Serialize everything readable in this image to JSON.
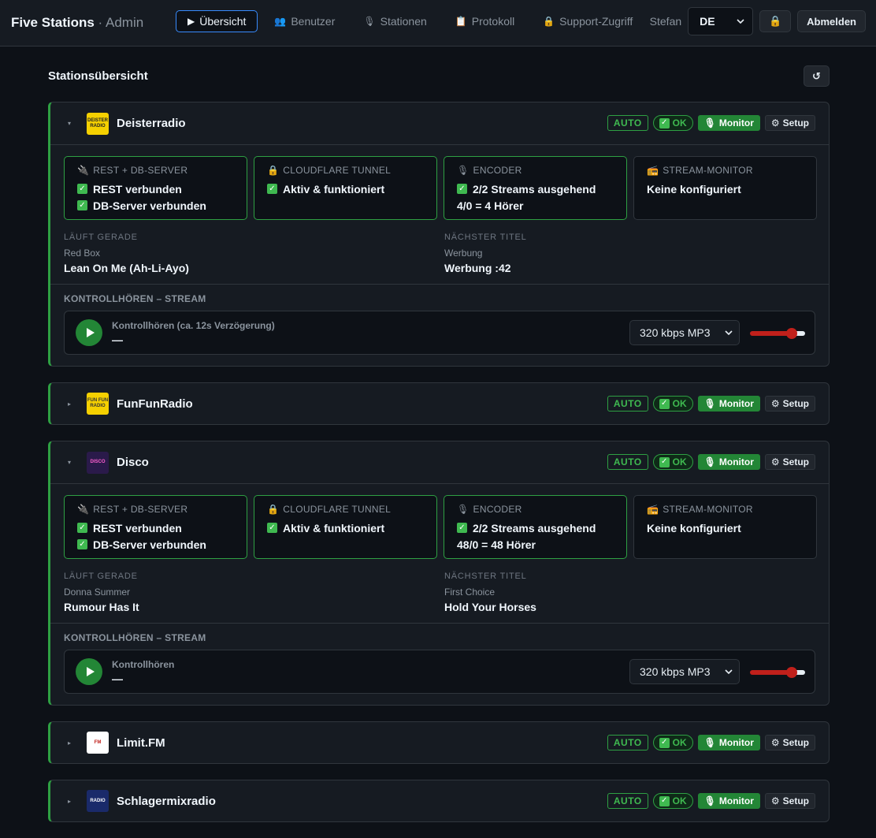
{
  "app": {
    "brand": "Five Stations",
    "sep": " · ",
    "sub": "Admin"
  },
  "nav": [
    {
      "label": "Übersicht",
      "icon": "▶",
      "active": true,
      "name": "tab-uebersicht"
    },
    {
      "label": "Benutzer",
      "icon": "👥",
      "active": false,
      "name": "tab-benutzer"
    },
    {
      "label": "Stationen",
      "icon": "🎙",
      "active": false,
      "name": "tab-stationen"
    },
    {
      "label": "Protokoll",
      "icon": "📋",
      "active": false,
      "name": "tab-protokoll"
    },
    {
      "label": "Support-Zugriff",
      "icon": "🔒",
      "active": false,
      "name": "tab-support"
    }
  ],
  "user": {
    "name": "Stefan",
    "language": "DE",
    "lock_icon": "🔒",
    "logout": "Abmelden"
  },
  "section": {
    "title": "Stationsübersicht",
    "refresh": "↺"
  },
  "badges": {
    "auto": "AUTO",
    "ok": "OK",
    "monitor": "Monitor",
    "setup": "Setup",
    "setup_icon": "⚙",
    "monitor_icon": "🎙"
  },
  "labels": {
    "rest": "REST + DB-SERVER",
    "tunnel": "CLOUDFLARE TUNNEL",
    "encoder": "ENCODER",
    "monitor": "STREAM-MONITOR",
    "now": "LÄUFT GERADE",
    "next": "NÄCHSTER TITEL",
    "listen": "KONTROLLHÖREN – STREAM",
    "rest_ok": "REST verbunden",
    "db_ok": "DB-Server verbunden",
    "tunnel_ok": "Aktiv & funktioniert",
    "monitor_none": "Keine konfiguriert"
  },
  "stations": [
    {
      "name": "Deisterradio",
      "expanded": true,
      "encoder_streams": "2/2 Streams ausgehend",
      "listeners": "4/0 = 4 Hörer",
      "now_artist": "Red Box",
      "now_title": "Lean On Me (Ah-Li-Ayo)",
      "next_artist": "Werbung",
      "next_title": "Werbung :42",
      "player_title": "Kontrollhören (ca. 12s Verzögerung)",
      "player_sub": "—",
      "quality": "320 kbps MP3",
      "volume": 0.75,
      "logo_text": "DEISTER RADIO",
      "logo_bg": "#f5d000",
      "logo_fg": "#222222"
    },
    {
      "name": "FunFunRadio",
      "expanded": false,
      "logo_text": "FUN FUN RADIO",
      "logo_bg": "#f5d000",
      "logo_fg": "#333333"
    },
    {
      "name": "Disco",
      "expanded": true,
      "encoder_streams": "2/2 Streams ausgehend",
      "listeners": "48/0 = 48 Hörer",
      "now_artist": "Donna Summer",
      "now_title": "Rumour Has It",
      "next_artist": "First Choice",
      "next_title": "Hold Your Horses",
      "player_title": "Kontrollhören",
      "player_sub": "—",
      "quality": "320 kbps MP3",
      "volume": 0.75,
      "logo_text": "DISCO",
      "logo_bg": "#2a1a4a",
      "logo_fg": "#ff5fd0"
    },
    {
      "name": "Limit.FM",
      "expanded": false,
      "logo_text": "FM",
      "logo_bg": "#ffffff",
      "logo_fg": "#c0201b"
    },
    {
      "name": "Schlagermixradio",
      "expanded": false,
      "logo_text": "RADIO",
      "logo_bg": "#1a2a6a",
      "logo_fg": "#ffffff"
    }
  ]
}
